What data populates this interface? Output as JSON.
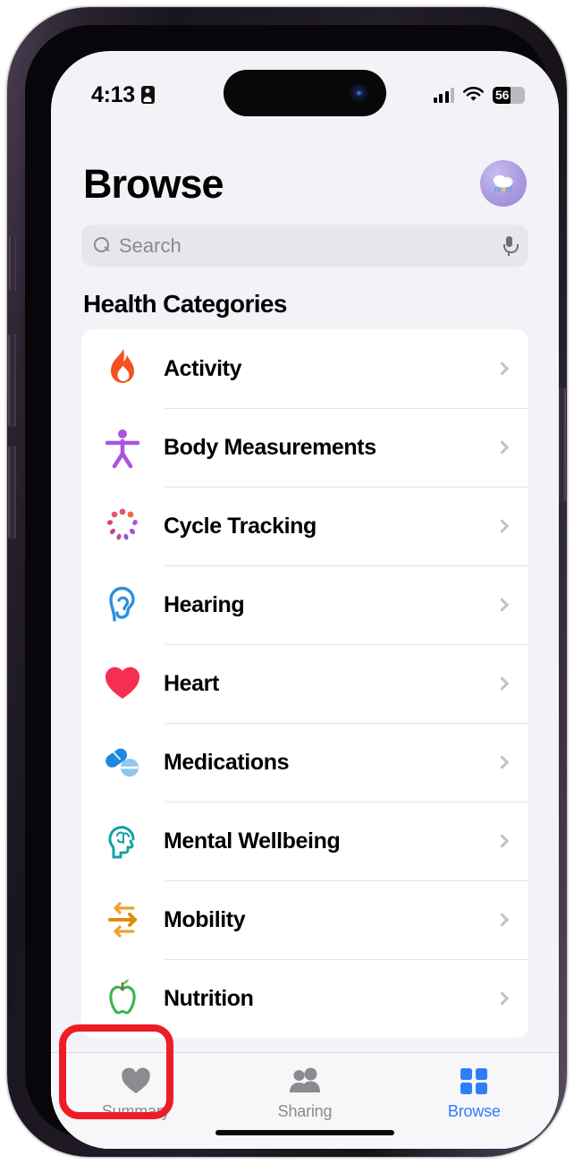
{
  "device": {
    "frame_color": "#2a222f",
    "screen_bg": "#f2f2f7"
  },
  "status_bar": {
    "time": "4:13",
    "record_icon": "screen-record-badge-icon",
    "cellular_icon": "cellular-signal-icon",
    "wifi_icon": "wifi-icon",
    "battery_level": "56",
    "battery_percent": 56
  },
  "header": {
    "title": "Browse",
    "avatar_emoji": "🌧",
    "avatar_name": "profile-avatar",
    "avatar_bg": "#a99ae0"
  },
  "search": {
    "placeholder": "Search",
    "value": "",
    "search_icon": "search-icon",
    "mic_icon": "microphone-icon"
  },
  "main": {
    "section_title": "Health Categories",
    "categories": [
      {
        "label": "Activity",
        "icon": "flame-icon",
        "color": "#f4511e"
      },
      {
        "label": "Body Measurements",
        "icon": "body-figure-icon",
        "color": "#a855e0"
      },
      {
        "label": "Cycle Tracking",
        "icon": "cycle-burst-icon",
        "color": "#e8506e"
      },
      {
        "label": "Hearing",
        "icon": "ear-icon",
        "color": "#2b8fe0"
      },
      {
        "label": "Heart",
        "icon": "heart-icon",
        "color": "#f52f52"
      },
      {
        "label": "Medications",
        "icon": "pills-icon",
        "color": "#2b8fe0"
      },
      {
        "label": "Mental Wellbeing",
        "icon": "brain-head-icon",
        "color": "#14a0a8"
      },
      {
        "label": "Mobility",
        "icon": "mobility-arrows-icon",
        "color": "#f0a02a"
      },
      {
        "label": "Nutrition",
        "icon": "apple-icon",
        "color": "#39b54a"
      }
    ],
    "chevron_icon": "chevron-right-icon"
  },
  "tab_bar": {
    "active_color": "#2d7ff9",
    "inactive_color": "#8a8a8f",
    "tabs": [
      {
        "label": "Summary",
        "icon": "heart-filled-icon",
        "active": false
      },
      {
        "label": "Sharing",
        "icon": "two-people-icon",
        "active": false
      },
      {
        "label": "Browse",
        "icon": "grid-squares-icon",
        "active": true
      }
    ]
  },
  "annotation": {
    "type": "highlight-rectangle",
    "target": "Summary",
    "color": "#ee1c25"
  }
}
